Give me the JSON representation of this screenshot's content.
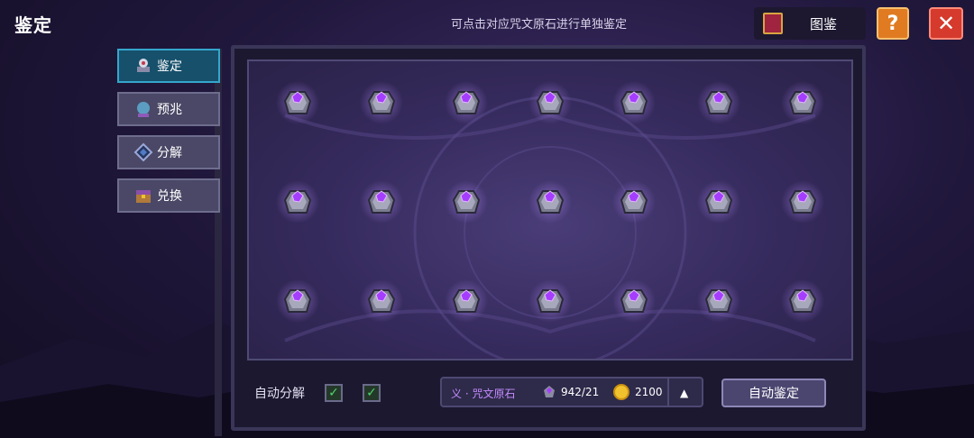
{
  "header": {
    "title": "鉴定",
    "hint": "可点击对应咒文原石进行单独鉴定",
    "codex_label": "图鉴",
    "help_label": "?",
    "close_label": "✕"
  },
  "tabs": [
    {
      "label": "鉴定",
      "icon": "appraise-icon",
      "active": true
    },
    {
      "label": "预兆",
      "icon": "omen-orb-icon",
      "active": false
    },
    {
      "label": "分解",
      "icon": "decompose-gem-icon",
      "active": false
    },
    {
      "label": "兑换",
      "icon": "exchange-chest-icon",
      "active": false
    }
  ],
  "stones": {
    "rows": 3,
    "cols": 7,
    "item_icon": "rune-ore-stone-icon"
  },
  "bottom": {
    "auto_decompose_label": "自动分解",
    "checkbox_1": "✓",
    "checkbox_2": "✓",
    "resource_name": "义 · 咒文原石",
    "gem_count": "942/21",
    "coin_count": "2100",
    "expand_arrow": "▲",
    "auto_appraise_label": "自动鉴定"
  },
  "colors": {
    "active_tab": "#17506b",
    "gem_purple": "#a53dff",
    "help_button": "#e07b21",
    "close_button": "#d53a2c"
  }
}
